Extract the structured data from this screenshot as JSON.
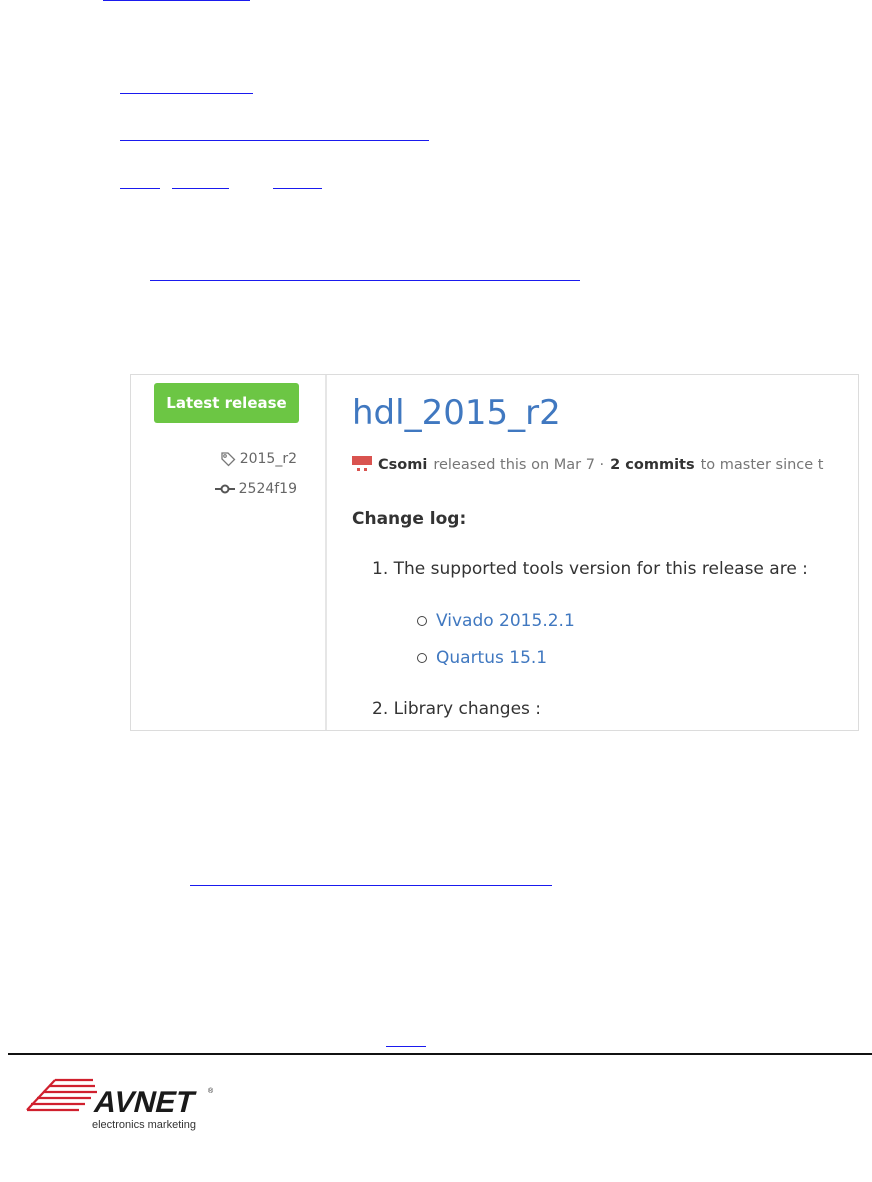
{
  "release_screenshot": {
    "badge": "Latest release",
    "tag": "2015_r2",
    "commit": "2524f19",
    "title": "hdl_2015_r2",
    "author": "Csomi",
    "released_text": "released this on Mar 7 ·",
    "commits": "2 commits",
    "since_text": "to master since t",
    "changelog_heading": "Change log:",
    "item1": "1. The supported tools version for this release are :",
    "tools": [
      "Vivado 2015.2.1",
      "Quartus 15.1"
    ],
    "item2": "2. Library changes :"
  },
  "footer": {
    "logo_word": "AVNET",
    "logo_tag": "electronics marketing",
    "colors": {
      "logo_red": "#d0202e",
      "logo_dark": "#1a1a1a"
    }
  },
  "colors": {
    "link_underline": "#1a1aee",
    "badge_green": "#6cc644",
    "github_blue": "#4078c0"
  }
}
